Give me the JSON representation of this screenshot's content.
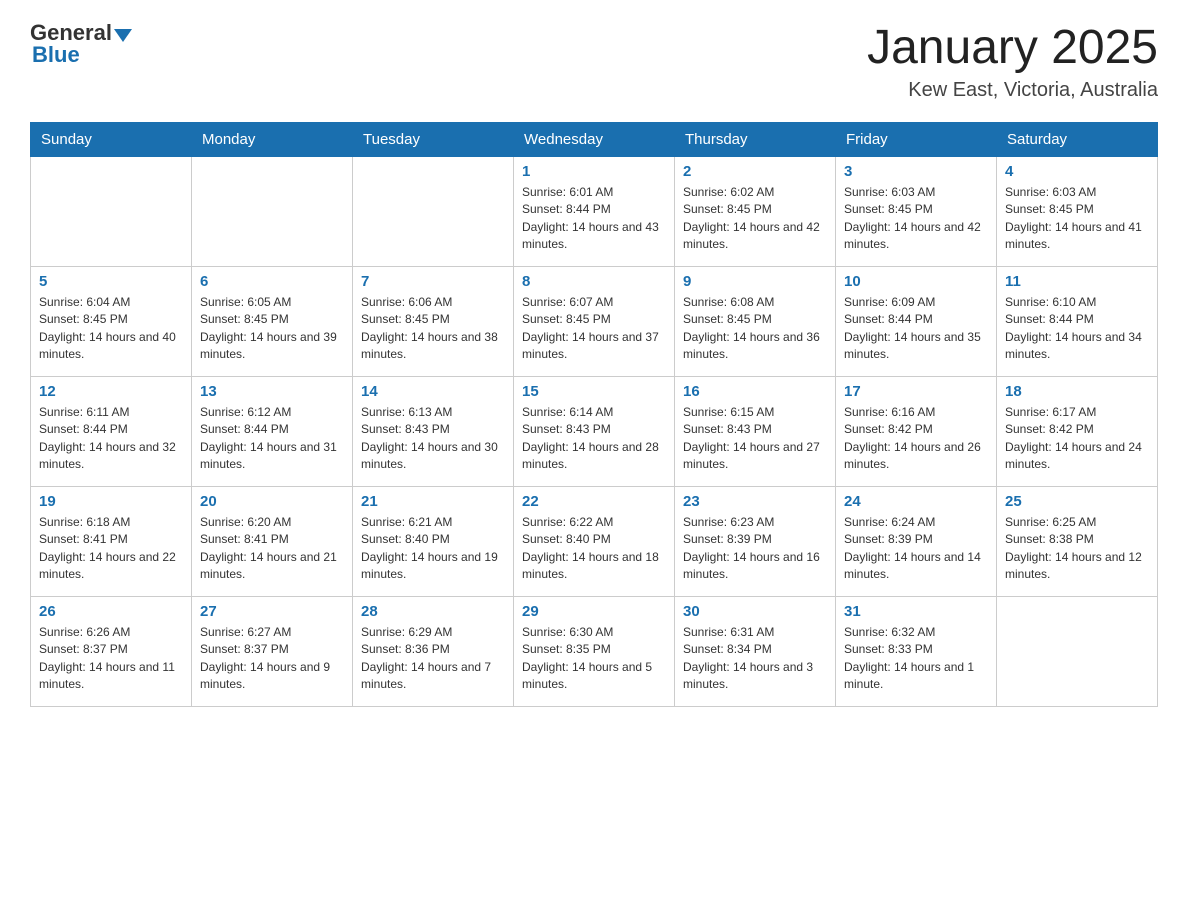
{
  "header": {
    "logo_general": "General",
    "logo_blue": "Blue",
    "title": "January 2025",
    "location": "Kew East, Victoria, Australia"
  },
  "days_of_week": [
    "Sunday",
    "Monday",
    "Tuesday",
    "Wednesday",
    "Thursday",
    "Friday",
    "Saturday"
  ],
  "weeks": [
    [
      {
        "day": "",
        "info": ""
      },
      {
        "day": "",
        "info": ""
      },
      {
        "day": "",
        "info": ""
      },
      {
        "day": "1",
        "info": "Sunrise: 6:01 AM\nSunset: 8:44 PM\nDaylight: 14 hours and 43 minutes."
      },
      {
        "day": "2",
        "info": "Sunrise: 6:02 AM\nSunset: 8:45 PM\nDaylight: 14 hours and 42 minutes."
      },
      {
        "day": "3",
        "info": "Sunrise: 6:03 AM\nSunset: 8:45 PM\nDaylight: 14 hours and 42 minutes."
      },
      {
        "day": "4",
        "info": "Sunrise: 6:03 AM\nSunset: 8:45 PM\nDaylight: 14 hours and 41 minutes."
      }
    ],
    [
      {
        "day": "5",
        "info": "Sunrise: 6:04 AM\nSunset: 8:45 PM\nDaylight: 14 hours and 40 minutes."
      },
      {
        "day": "6",
        "info": "Sunrise: 6:05 AM\nSunset: 8:45 PM\nDaylight: 14 hours and 39 minutes."
      },
      {
        "day": "7",
        "info": "Sunrise: 6:06 AM\nSunset: 8:45 PM\nDaylight: 14 hours and 38 minutes."
      },
      {
        "day": "8",
        "info": "Sunrise: 6:07 AM\nSunset: 8:45 PM\nDaylight: 14 hours and 37 minutes."
      },
      {
        "day": "9",
        "info": "Sunrise: 6:08 AM\nSunset: 8:45 PM\nDaylight: 14 hours and 36 minutes."
      },
      {
        "day": "10",
        "info": "Sunrise: 6:09 AM\nSunset: 8:44 PM\nDaylight: 14 hours and 35 minutes."
      },
      {
        "day": "11",
        "info": "Sunrise: 6:10 AM\nSunset: 8:44 PM\nDaylight: 14 hours and 34 minutes."
      }
    ],
    [
      {
        "day": "12",
        "info": "Sunrise: 6:11 AM\nSunset: 8:44 PM\nDaylight: 14 hours and 32 minutes."
      },
      {
        "day": "13",
        "info": "Sunrise: 6:12 AM\nSunset: 8:44 PM\nDaylight: 14 hours and 31 minutes."
      },
      {
        "day": "14",
        "info": "Sunrise: 6:13 AM\nSunset: 8:43 PM\nDaylight: 14 hours and 30 minutes."
      },
      {
        "day": "15",
        "info": "Sunrise: 6:14 AM\nSunset: 8:43 PM\nDaylight: 14 hours and 28 minutes."
      },
      {
        "day": "16",
        "info": "Sunrise: 6:15 AM\nSunset: 8:43 PM\nDaylight: 14 hours and 27 minutes."
      },
      {
        "day": "17",
        "info": "Sunrise: 6:16 AM\nSunset: 8:42 PM\nDaylight: 14 hours and 26 minutes."
      },
      {
        "day": "18",
        "info": "Sunrise: 6:17 AM\nSunset: 8:42 PM\nDaylight: 14 hours and 24 minutes."
      }
    ],
    [
      {
        "day": "19",
        "info": "Sunrise: 6:18 AM\nSunset: 8:41 PM\nDaylight: 14 hours and 22 minutes."
      },
      {
        "day": "20",
        "info": "Sunrise: 6:20 AM\nSunset: 8:41 PM\nDaylight: 14 hours and 21 minutes."
      },
      {
        "day": "21",
        "info": "Sunrise: 6:21 AM\nSunset: 8:40 PM\nDaylight: 14 hours and 19 minutes."
      },
      {
        "day": "22",
        "info": "Sunrise: 6:22 AM\nSunset: 8:40 PM\nDaylight: 14 hours and 18 minutes."
      },
      {
        "day": "23",
        "info": "Sunrise: 6:23 AM\nSunset: 8:39 PM\nDaylight: 14 hours and 16 minutes."
      },
      {
        "day": "24",
        "info": "Sunrise: 6:24 AM\nSunset: 8:39 PM\nDaylight: 14 hours and 14 minutes."
      },
      {
        "day": "25",
        "info": "Sunrise: 6:25 AM\nSunset: 8:38 PM\nDaylight: 14 hours and 12 minutes."
      }
    ],
    [
      {
        "day": "26",
        "info": "Sunrise: 6:26 AM\nSunset: 8:37 PM\nDaylight: 14 hours and 11 minutes."
      },
      {
        "day": "27",
        "info": "Sunrise: 6:27 AM\nSunset: 8:37 PM\nDaylight: 14 hours and 9 minutes."
      },
      {
        "day": "28",
        "info": "Sunrise: 6:29 AM\nSunset: 8:36 PM\nDaylight: 14 hours and 7 minutes."
      },
      {
        "day": "29",
        "info": "Sunrise: 6:30 AM\nSunset: 8:35 PM\nDaylight: 14 hours and 5 minutes."
      },
      {
        "day": "30",
        "info": "Sunrise: 6:31 AM\nSunset: 8:34 PM\nDaylight: 14 hours and 3 minutes."
      },
      {
        "day": "31",
        "info": "Sunrise: 6:32 AM\nSunset: 8:33 PM\nDaylight: 14 hours and 1 minute."
      },
      {
        "day": "",
        "info": ""
      }
    ]
  ]
}
